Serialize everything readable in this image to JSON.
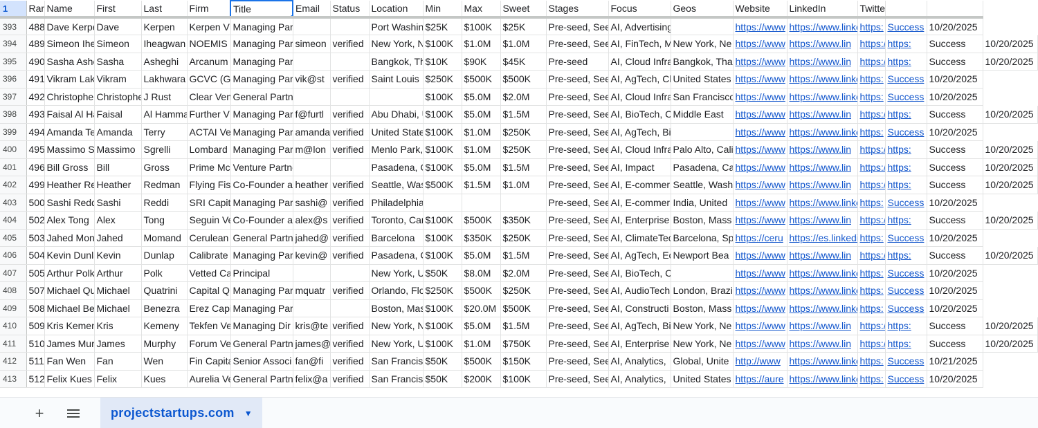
{
  "header": {
    "corner": "1",
    "columns": [
      "Rar",
      "Name",
      "First",
      "Last",
      "Firm",
      "Title",
      "Email",
      "Status",
      "Location",
      "Min",
      "Max",
      "Sweet",
      "Stages",
      "Focus",
      "Geos",
      "Website",
      "LinkedIn",
      "Twitter",
      "",
      ""
    ]
  },
  "rows": [
    {
      "n": "393",
      "c": [
        "488",
        "Dave Kerpe",
        "Dave",
        "Kerpen",
        "Kerpen V",
        "Managing Partner",
        "",
        "",
        "Port Washin",
        "$25K",
        "$100K",
        "$25K",
        "Pre-seed, See",
        "AI, Advertising, AgTech, Ana",
        "",
        "https://www",
        "https://www.linkedin.com/ir",
        "https:",
        "Success",
        "10/20/2025"
      ]
    },
    {
      "n": "394",
      "c": [
        "489",
        "Simeon Ihe",
        "Simeon",
        "Iheagwan",
        "NOEMIS",
        "Managing Par",
        "simeon",
        "verified",
        "New York, N",
        "$100K",
        "$1.0M",
        "$1.0M",
        "Pre-seed, See",
        "AI, FinTech, M",
        "New York, Ne",
        "https://www",
        "https://www.lin",
        "https://www",
        "https:",
        "Success",
        "10/20/2025"
      ]
    },
    {
      "n": "395",
      "c": [
        "490",
        "Sasha Ashe",
        "Sasha",
        "Asheghi",
        "Arcanum",
        "Managing Partner",
        "",
        "",
        "Bangkok, Th",
        "$10K",
        "$90K",
        "$45K",
        "Pre-seed",
        "AI, Cloud Infra",
        "Bangkok, Tha",
        "https://www",
        "https://www.lin",
        "https://www",
        "https:",
        "Success",
        "10/20/2025"
      ]
    },
    {
      "n": "396",
      "c": [
        "491",
        "Vikram Lakl",
        "Vikram",
        "Lakhwara",
        "GCVC (Gr",
        "Managing Par",
        "vik@st",
        "verified",
        "Saint Louis",
        "$250K",
        "$500K",
        "$500K",
        "Pre-seed, See",
        "AI, AgTech, Cl",
        "United States",
        "https://www",
        "https://www.linkedin.com/ir",
        "https:",
        "Success",
        "10/20/2025"
      ]
    },
    {
      "n": "397",
      "c": [
        "492",
        "Christopher",
        "Christophe",
        "J Rust",
        "Clear Ven",
        "General Partner",
        "",
        "",
        "",
        "$100K",
        "$5.0M",
        "$2.0M",
        "Pre-seed, See",
        "AI, Cloud Infra",
        "San Francisco",
        "https://www",
        "https://www.linkedin.com/ir",
        "https:",
        "Success",
        "10/20/2025"
      ]
    },
    {
      "n": "398",
      "c": [
        "493",
        "Faisal Al Ha",
        "Faisal",
        "Al Hamma",
        "Further V",
        "Managing Par",
        "f@furtl",
        "verified",
        "Abu Dhabi, U",
        "$100K",
        "$5.0M",
        "$1.5M",
        "Pre-seed, See",
        "AI, BioTech, C",
        "Middle East",
        "https://www",
        "https://www.lin",
        "https://www",
        "https:",
        "Success",
        "10/20/2025"
      ]
    },
    {
      "n": "399",
      "c": [
        "494",
        "Amanda Te",
        "Amanda",
        "Terry",
        "ACTAI Ve",
        "Managing Par",
        "amanda",
        "verified",
        "United State",
        "$100K",
        "$1.0M",
        "$250K",
        "Pre-seed, See",
        "AI, AgTech, BioTech, Climate",
        "",
        "https://www",
        "https://www.linkedin.com/ir",
        "https:",
        "Success",
        "10/20/2025"
      ]
    },
    {
      "n": "400",
      "c": [
        "495",
        "Massimo Sg",
        "Massimo",
        "Sgrelli",
        "Lombard",
        "Managing Par",
        "m@lon",
        "verified",
        "Menlo Park,",
        "$100K",
        "$1.0M",
        "$250K",
        "Pre-seed, See",
        "AI, Cloud Infra",
        "Palo Alto, Cali",
        "https://www",
        "https://www.lin",
        "https://www",
        "https:",
        "Success",
        "10/20/2025"
      ]
    },
    {
      "n": "401",
      "c": [
        "496",
        "Bill Gross",
        "Bill",
        "Gross",
        "Prime Mc",
        "Venture Partner",
        "",
        "",
        "Pasadena, C",
        "$100K",
        "$5.0M",
        "$1.5M",
        "Pre-seed, See",
        "AI, Impact",
        "Pasadena, Cal",
        "https://www",
        "https://www.lin",
        "https://www",
        "https:",
        "Success",
        "10/20/2025"
      ]
    },
    {
      "n": "402",
      "c": [
        "499",
        "Heather Re",
        "Heather",
        "Redman",
        "Flying Fis",
        "Co-Founder a",
        "heather",
        "verified",
        "Seattle, Was",
        "$500K",
        "$1.5M",
        "$1.0M",
        "Pre-seed, See",
        "AI, E-commer",
        "Seattle, Wash",
        "https://www",
        "https://www.lin",
        "https://www",
        "https:",
        "Success",
        "10/20/2025"
      ]
    },
    {
      "n": "403",
      "c": [
        "500",
        "Sashi Reddi",
        "Sashi",
        "Reddi",
        "SRI Capit",
        "Managing Par",
        "sashi@",
        "verified",
        "Philadelphia",
        "",
        "",
        "",
        "Pre-seed, See",
        "AI, E-commer",
        "India, United",
        "https://www",
        "https://www.linkedin.com/ir",
        "https:",
        "Success",
        "10/20/2025"
      ]
    },
    {
      "n": "404",
      "c": [
        "502",
        "Alex Tong",
        "Alex",
        "Tong",
        "Seguin Ve",
        "Co-Founder a",
        "alex@s",
        "verified",
        "Toronto, Car",
        "$100K",
        "$500K",
        "$350K",
        "Pre-seed, See",
        "AI, Enterprise",
        "Boston, Mass",
        "https://www",
        "https://www.lin",
        "https://x.co",
        "https:",
        "Success",
        "10/20/2025"
      ]
    },
    {
      "n": "405",
      "c": [
        "503",
        "Jahed Mon",
        "Jahed",
        "Momand",
        "Cerulean",
        "General Partn",
        "jahed@",
        "verified",
        "Barcelona",
        "$100K",
        "$350K",
        "$250K",
        "Pre-seed, See",
        "AI, ClimateTec",
        "Barcelona, Sp",
        "https://ceru",
        "https://es.linkedin.com/in/jal",
        "https:",
        "Success",
        "10/20/2025"
      ]
    },
    {
      "n": "406",
      "c": [
        "504",
        "Kevin Dunla",
        "Kevin",
        "Dunlap",
        "Calibrate",
        "Managing Par",
        "kevin@",
        "verified",
        "Pasadena, C",
        "$100K",
        "$5.0M",
        "$1.5M",
        "Pre-seed, See",
        "AI, AgTech, Ec",
        "Newport Bea",
        "https://www",
        "https://www.lin",
        "https://www",
        "https:",
        "Success",
        "10/20/2025"
      ]
    },
    {
      "n": "407",
      "c": [
        "505",
        "Arthur Polk",
        "Arthur",
        "Polk",
        "Vetted Ca",
        "Principal",
        "",
        "",
        "New York, U",
        "$50K",
        "$8.0M",
        "$2.0M",
        "Pre-seed, See",
        "AI, BioTech, Consumer Healt",
        "",
        "https://www",
        "https://www.linkedin.com/ir",
        "https:",
        "Success",
        "10/20/2025"
      ]
    },
    {
      "n": "408",
      "c": [
        "507",
        "Michael Qu",
        "Michael",
        "Quatrini",
        "Capital Q",
        "Managing Par",
        "mquatr",
        "verified",
        "Orlando, Flo",
        "$250K",
        "$500K",
        "$250K",
        "Pre-seed, See",
        "AI, AudioTech",
        "London, Brazi",
        "https://www",
        "https://www.linkedin.com/ir",
        "https:",
        "Success",
        "10/20/2025"
      ]
    },
    {
      "n": "409",
      "c": [
        "508",
        "Michael Be",
        "Michael",
        "Benezra",
        "Erez Capi",
        "Managing Partner",
        "",
        "",
        "Boston, Mas",
        "$100K",
        "$20.0M",
        "$500K",
        "Pre-seed, See",
        "AI, Constructi",
        "Boston, Mass",
        "https://www",
        "https://www.linkedin.com/ir",
        "https:",
        "Success",
        "10/20/2025"
      ]
    },
    {
      "n": "410",
      "c": [
        "509",
        "Kris Kemen",
        "Kris",
        "Kemeny",
        "Tekfen Ve",
        "Managing Dir",
        "kris@te",
        "verified",
        "New York, N",
        "$100K",
        "$5.0M",
        "$1.5M",
        "Pre-seed, See",
        "AI, AgTech, Bi",
        "New York, Ne",
        "https://www",
        "https://www.lin",
        "https://www",
        "https:",
        "Success",
        "10/20/2025"
      ]
    },
    {
      "n": "411",
      "c": [
        "510",
        "James Mur",
        "James",
        "Murphy",
        "Forum Ve",
        "General Partn",
        "james@",
        "verified",
        "New York, U",
        "$100K",
        "$1.0M",
        "$750K",
        "Pre-seed, See",
        "AI, Enterprise",
        "New York, Ne",
        "https://www",
        "https://www.lin",
        "https://www",
        "https:",
        "Success",
        "10/20/2025"
      ]
    },
    {
      "n": "412",
      "c": [
        "511",
        "Fan Wen",
        "Fan",
        "Wen",
        "Fin Capita",
        "Senior Associ",
        "fan@fi",
        "verified",
        "San Francisc",
        "$50K",
        "$500K",
        "$150K",
        "Pre-seed, See",
        "AI, Analytics,",
        "Global, Unite",
        "http://www",
        "https://www.linkedin.com/ir",
        "https:",
        "Success",
        "10/21/2025"
      ]
    },
    {
      "n": "413",
      "c": [
        "512",
        "Felix Kues",
        "Felix",
        "Kues",
        "Aurelia Ve",
        "General Partn",
        "felix@a",
        "verified",
        "San Francisc",
        "$50K",
        "$200K",
        "$100K",
        "Pre-seed, See",
        "AI, Analytics,",
        "United States",
        "https://aure",
        "https://www.linkedin.com/ir",
        "https:",
        "Success",
        "10/20/2025"
      ]
    }
  ],
  "bottom_bar": {
    "add_sheet_symbol": "+",
    "sheet_tab_label": "projectstartups.com"
  },
  "icons": {
    "add": "plus-icon",
    "all_sheets": "hamburger-menu-icon",
    "tab_menu": "caret-down-icon"
  },
  "colors": {
    "link": "#1155cc",
    "selection": "#1a73e8",
    "tab_bg": "#e1e9f7",
    "tab_text": "#0b57d0"
  }
}
